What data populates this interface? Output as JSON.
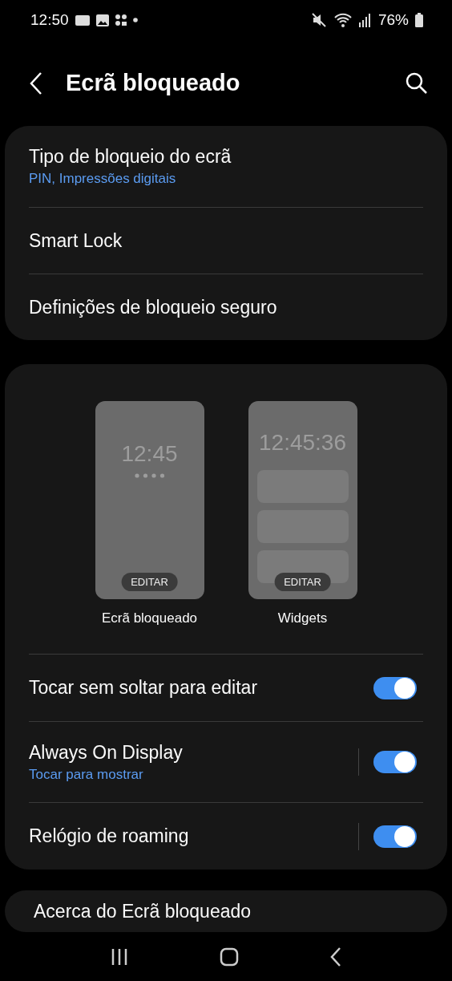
{
  "status_bar": {
    "time": "12:50",
    "battery": "76%"
  },
  "header": {
    "title": "Ecrã bloqueado"
  },
  "security_card": [
    {
      "title": "Tipo de bloqueio do ecrã",
      "subtitle": "PIN, Impressões digitais"
    },
    {
      "title": "Smart Lock"
    },
    {
      "title": "Definições de bloqueio seguro"
    }
  ],
  "previews": [
    {
      "kind": "lock",
      "clock": "12:45",
      "button": "EDITAR",
      "label": "Ecrã bloqueado"
    },
    {
      "kind": "widgets",
      "clock": "12:45:36",
      "button": "EDITAR",
      "label": "Widgets"
    }
  ],
  "toggles": [
    {
      "title": "Tocar sem soltar para editar",
      "on": true,
      "split": false
    },
    {
      "title": "Always On Display",
      "subtitle": "Tocar para mostrar",
      "on": true,
      "split": true
    },
    {
      "title": "Relógio de roaming",
      "on": true,
      "split": true
    }
  ],
  "about_card": {
    "title": "Acerca do Ecrã bloqueado"
  }
}
